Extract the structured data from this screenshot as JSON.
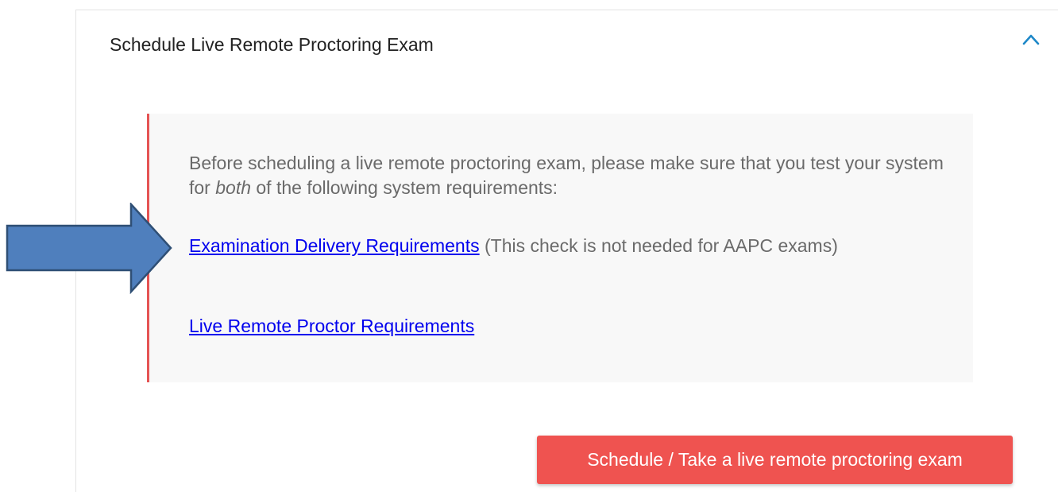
{
  "panel": {
    "title": "Schedule Live Remote Proctoring Exam",
    "collapse_icon": "chevron-up-icon"
  },
  "notice": {
    "intro_before": "Before scheduling a live remote proctoring exam, please make sure that you test your system for ",
    "intro_emphasis": "both",
    "intro_after": " of the following system requirements:",
    "requirement_1_link": "Examination Delivery Requirements",
    "requirement_1_note": " (This check is not needed for AAPC exams)",
    "requirement_2_link": "Live Remote Proctor Requirements"
  },
  "actions": {
    "schedule_button": "Schedule / Take a live remote proctoring exam"
  },
  "annotation": {
    "icon": "arrow-right-icon"
  },
  "colors": {
    "accent_red": "#ef5350",
    "notice_border": "#e55353",
    "chevron_blue": "#1e88c8",
    "link_blue": "#0000ee",
    "arrow_fill": "#4f7fbd",
    "arrow_stroke": "#2f4f75"
  }
}
